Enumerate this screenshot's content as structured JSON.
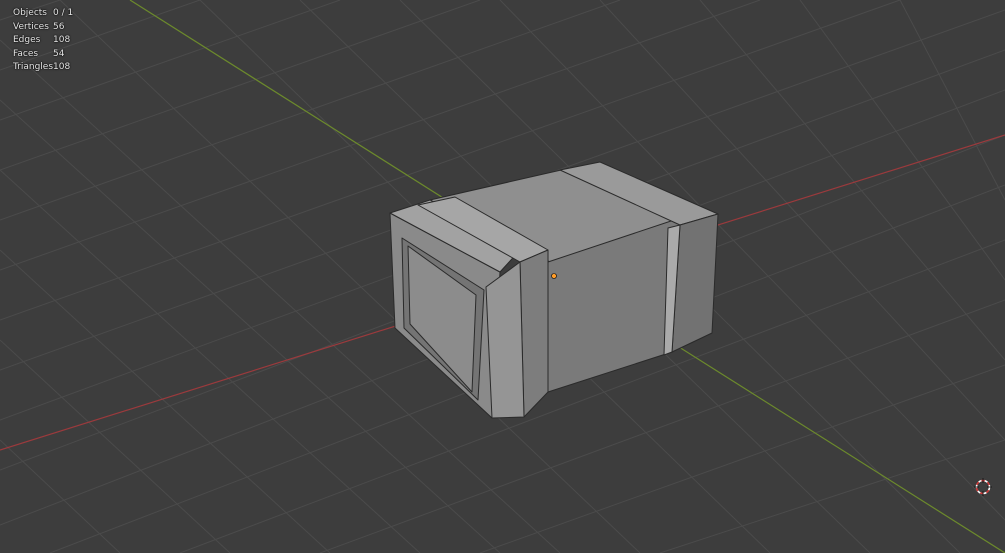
{
  "overlay": {
    "stats": [
      {
        "label": "Objects",
        "value": "0 / 1"
      },
      {
        "label": "Vertices",
        "value": "56"
      },
      {
        "label": "Edges",
        "value": "108"
      },
      {
        "label": "Faces",
        "value": "54"
      },
      {
        "label": "Triangles",
        "value": "108"
      }
    ]
  },
  "scene": {
    "object_type": "crate",
    "icons": [
      "3d-cursor-icon",
      "origin-point-icon"
    ]
  },
  "colors": {
    "background": "#3d3d3d",
    "grid": "#4b4b4b",
    "x_axis": "#9b3a3d",
    "y_axis": "#6c8a2c",
    "origin": "#ff9d2a"
  }
}
